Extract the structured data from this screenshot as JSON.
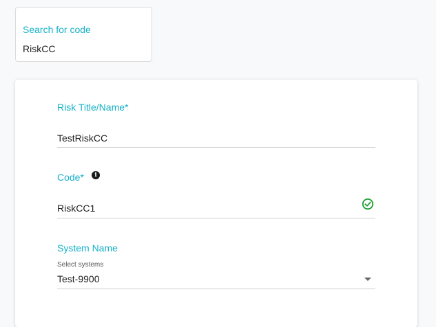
{
  "search": {
    "label": "Search for code",
    "value": "RiskCC"
  },
  "form": {
    "risk_title": {
      "label": "Risk Title/Name*",
      "value": "TestRiskCC"
    },
    "code": {
      "label": "Code*",
      "value": "RiskCC1",
      "info_icon": "info-icon",
      "info_glyph": "i",
      "status_icon": "check-circle-icon",
      "status_color": "#1a9e2d"
    },
    "system_name": {
      "label": "System Name",
      "helper": "Select systems",
      "value": "Test-9900",
      "dropdown_icon": "caret-down-icon"
    }
  },
  "colors": {
    "accent": "#16b1c7",
    "success": "#1a9e2d"
  }
}
